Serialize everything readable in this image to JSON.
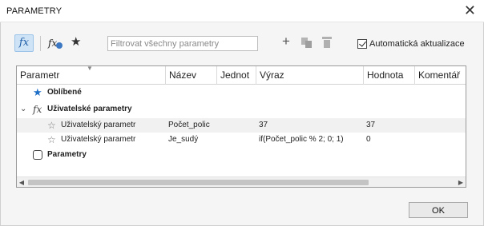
{
  "window": {
    "title": "PARAMETRY",
    "close_glyph": "✕"
  },
  "toolbar": {
    "filter_placeholder": "Filtrovat všechny parametry",
    "auto_update_label": "Automatická aktualizace",
    "auto_update_checked": true,
    "icons": [
      "fx-icon",
      "user-fx-icon",
      "star-icon",
      "plus-icon",
      "copy-icon",
      "trash-icon"
    ]
  },
  "table": {
    "columns": [
      "Parametr",
      "Název",
      "Jednot",
      "Výraz",
      "Hodnota",
      "Komentář"
    ],
    "categories": [
      {
        "label": "Oblíbené",
        "icon": "star-icon"
      },
      {
        "label": "Uživatelské parametry",
        "icon": "fx-icon",
        "expanded": true
      },
      {
        "label": "Parametry",
        "icon": "parameter-icon"
      }
    ],
    "rows": [
      {
        "parametr": "Uživatelský parametr",
        "nazev": "Počet_polic",
        "jednotka": "",
        "vyraz": "37",
        "hodnota": "37",
        "komentar": ""
      },
      {
        "parametr": "Uživatelský parametr",
        "nazev": "Je_sudý",
        "jednotka": "",
        "vyraz": "if(Počet_polic % 2; 0; 1)",
        "hodnota": "0",
        "komentar": ""
      }
    ]
  },
  "footer": {
    "ok_label": "OK"
  },
  "colors": {
    "accent": "#1f6fc7",
    "active_tool_bg": "#cfe3f6"
  }
}
